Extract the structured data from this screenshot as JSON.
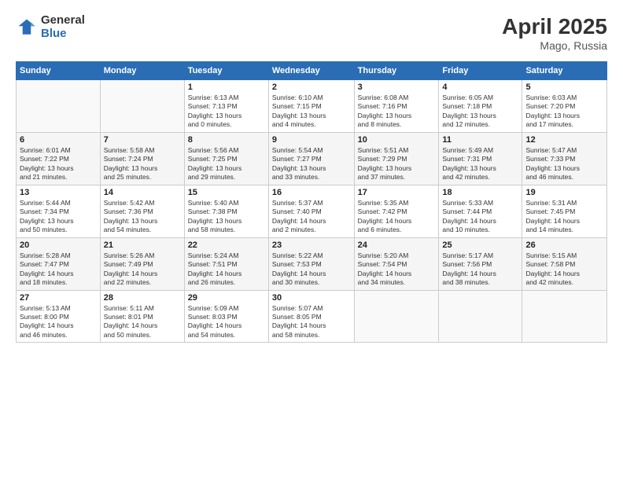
{
  "logo": {
    "general": "General",
    "blue": "Blue"
  },
  "title": {
    "month": "April 2025",
    "location": "Mago, Russia"
  },
  "weekdays": [
    "Sunday",
    "Monday",
    "Tuesday",
    "Wednesday",
    "Thursday",
    "Friday",
    "Saturday"
  ],
  "weeks": [
    [
      {
        "day": "",
        "info": ""
      },
      {
        "day": "",
        "info": ""
      },
      {
        "day": "1",
        "info": "Sunrise: 6:13 AM\nSunset: 7:13 PM\nDaylight: 13 hours\nand 0 minutes."
      },
      {
        "day": "2",
        "info": "Sunrise: 6:10 AM\nSunset: 7:15 PM\nDaylight: 13 hours\nand 4 minutes."
      },
      {
        "day": "3",
        "info": "Sunrise: 6:08 AM\nSunset: 7:16 PM\nDaylight: 13 hours\nand 8 minutes."
      },
      {
        "day": "4",
        "info": "Sunrise: 6:05 AM\nSunset: 7:18 PM\nDaylight: 13 hours\nand 12 minutes."
      },
      {
        "day": "5",
        "info": "Sunrise: 6:03 AM\nSunset: 7:20 PM\nDaylight: 13 hours\nand 17 minutes."
      }
    ],
    [
      {
        "day": "6",
        "info": "Sunrise: 6:01 AM\nSunset: 7:22 PM\nDaylight: 13 hours\nand 21 minutes."
      },
      {
        "day": "7",
        "info": "Sunrise: 5:58 AM\nSunset: 7:24 PM\nDaylight: 13 hours\nand 25 minutes."
      },
      {
        "day": "8",
        "info": "Sunrise: 5:56 AM\nSunset: 7:25 PM\nDaylight: 13 hours\nand 29 minutes."
      },
      {
        "day": "9",
        "info": "Sunrise: 5:54 AM\nSunset: 7:27 PM\nDaylight: 13 hours\nand 33 minutes."
      },
      {
        "day": "10",
        "info": "Sunrise: 5:51 AM\nSunset: 7:29 PM\nDaylight: 13 hours\nand 37 minutes."
      },
      {
        "day": "11",
        "info": "Sunrise: 5:49 AM\nSunset: 7:31 PM\nDaylight: 13 hours\nand 42 minutes."
      },
      {
        "day": "12",
        "info": "Sunrise: 5:47 AM\nSunset: 7:33 PM\nDaylight: 13 hours\nand 46 minutes."
      }
    ],
    [
      {
        "day": "13",
        "info": "Sunrise: 5:44 AM\nSunset: 7:34 PM\nDaylight: 13 hours\nand 50 minutes."
      },
      {
        "day": "14",
        "info": "Sunrise: 5:42 AM\nSunset: 7:36 PM\nDaylight: 13 hours\nand 54 minutes."
      },
      {
        "day": "15",
        "info": "Sunrise: 5:40 AM\nSunset: 7:38 PM\nDaylight: 13 hours\nand 58 minutes."
      },
      {
        "day": "16",
        "info": "Sunrise: 5:37 AM\nSunset: 7:40 PM\nDaylight: 14 hours\nand 2 minutes."
      },
      {
        "day": "17",
        "info": "Sunrise: 5:35 AM\nSunset: 7:42 PM\nDaylight: 14 hours\nand 6 minutes."
      },
      {
        "day": "18",
        "info": "Sunrise: 5:33 AM\nSunset: 7:44 PM\nDaylight: 14 hours\nand 10 minutes."
      },
      {
        "day": "19",
        "info": "Sunrise: 5:31 AM\nSunset: 7:45 PM\nDaylight: 14 hours\nand 14 minutes."
      }
    ],
    [
      {
        "day": "20",
        "info": "Sunrise: 5:28 AM\nSunset: 7:47 PM\nDaylight: 14 hours\nand 18 minutes."
      },
      {
        "day": "21",
        "info": "Sunrise: 5:26 AM\nSunset: 7:49 PM\nDaylight: 14 hours\nand 22 minutes."
      },
      {
        "day": "22",
        "info": "Sunrise: 5:24 AM\nSunset: 7:51 PM\nDaylight: 14 hours\nand 26 minutes."
      },
      {
        "day": "23",
        "info": "Sunrise: 5:22 AM\nSunset: 7:53 PM\nDaylight: 14 hours\nand 30 minutes."
      },
      {
        "day": "24",
        "info": "Sunrise: 5:20 AM\nSunset: 7:54 PM\nDaylight: 14 hours\nand 34 minutes."
      },
      {
        "day": "25",
        "info": "Sunrise: 5:17 AM\nSunset: 7:56 PM\nDaylight: 14 hours\nand 38 minutes."
      },
      {
        "day": "26",
        "info": "Sunrise: 5:15 AM\nSunset: 7:58 PM\nDaylight: 14 hours\nand 42 minutes."
      }
    ],
    [
      {
        "day": "27",
        "info": "Sunrise: 5:13 AM\nSunset: 8:00 PM\nDaylight: 14 hours\nand 46 minutes."
      },
      {
        "day": "28",
        "info": "Sunrise: 5:11 AM\nSunset: 8:01 PM\nDaylight: 14 hours\nand 50 minutes."
      },
      {
        "day": "29",
        "info": "Sunrise: 5:09 AM\nSunset: 8:03 PM\nDaylight: 14 hours\nand 54 minutes."
      },
      {
        "day": "30",
        "info": "Sunrise: 5:07 AM\nSunset: 8:05 PM\nDaylight: 14 hours\nand 58 minutes."
      },
      {
        "day": "",
        "info": ""
      },
      {
        "day": "",
        "info": ""
      },
      {
        "day": "",
        "info": ""
      }
    ]
  ]
}
